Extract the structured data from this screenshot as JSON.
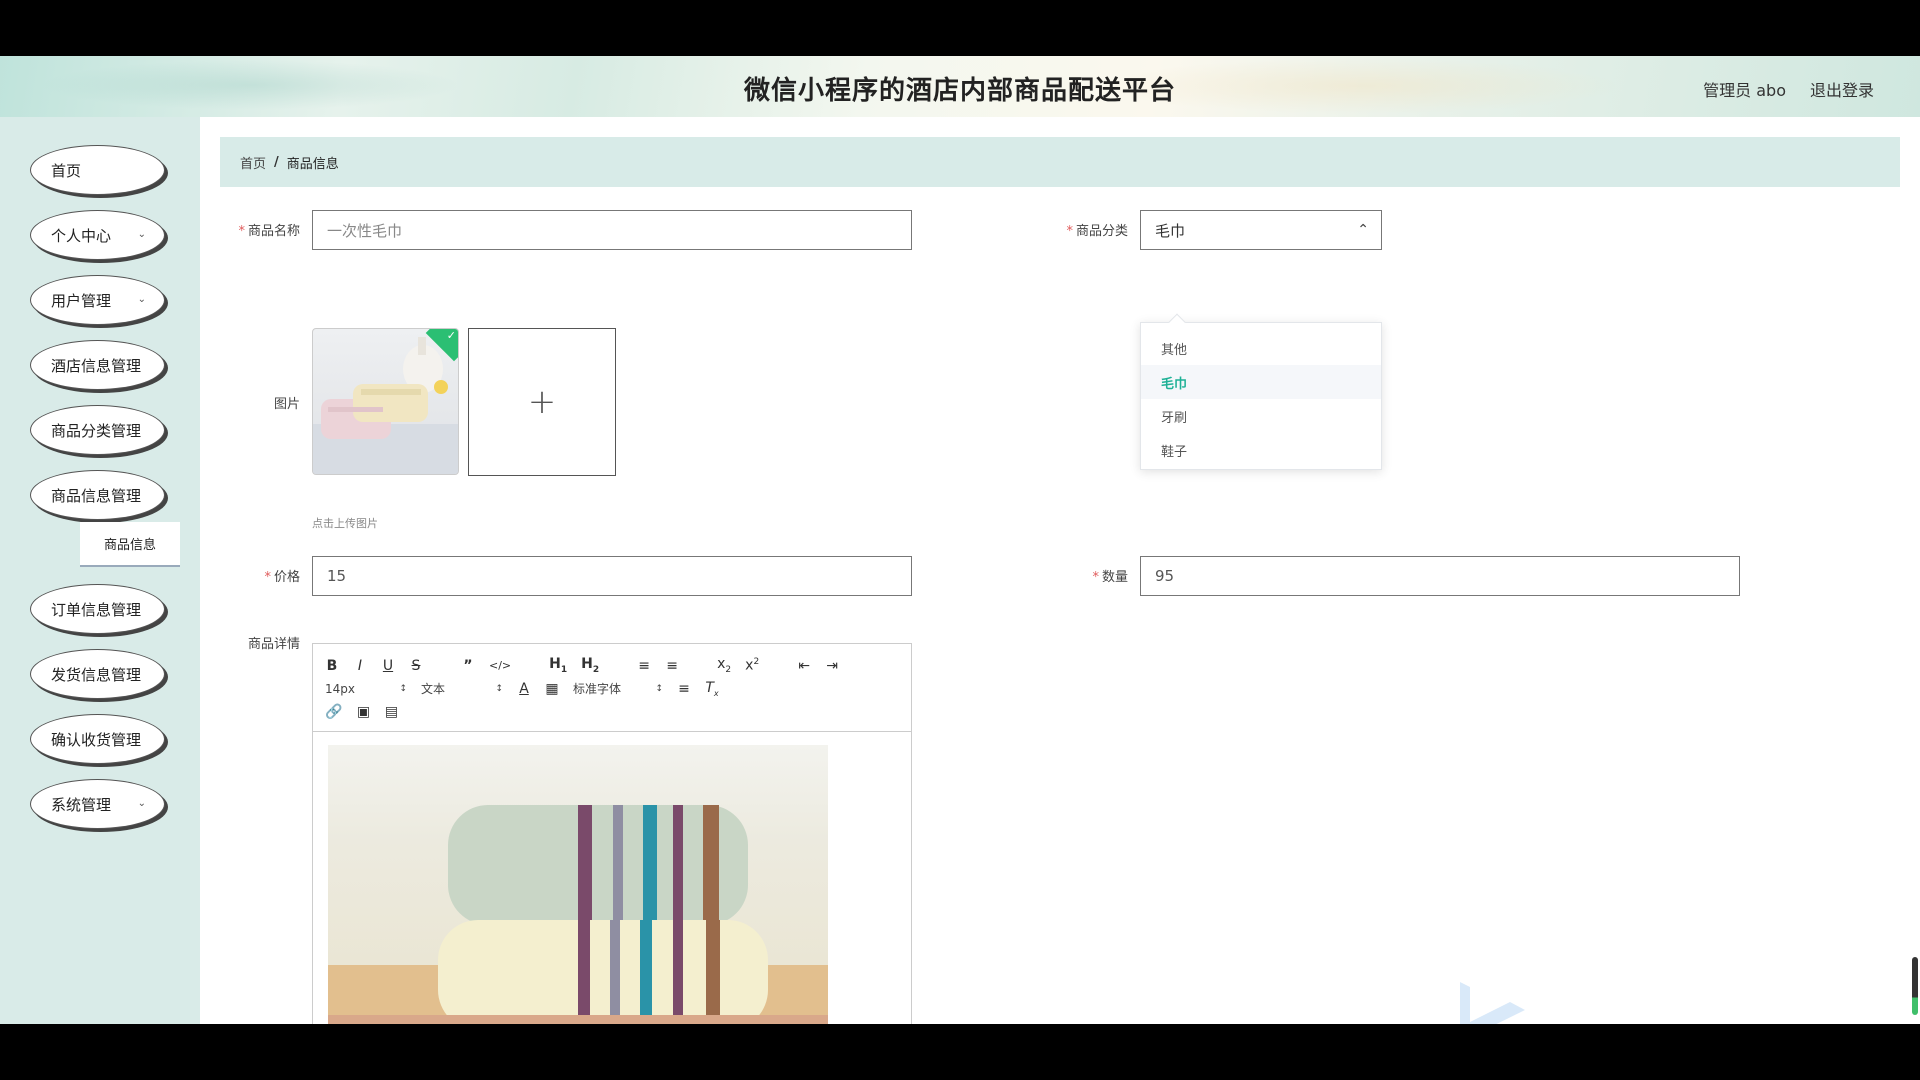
{
  "header": {
    "title": "微信小程序的酒店内部商品配送平台",
    "user_label": "管理员 abo",
    "logout_label": "退出登录"
  },
  "sidebar": {
    "items": [
      {
        "label": "首页",
        "expandable": false
      },
      {
        "label": "个人中心",
        "expandable": true
      },
      {
        "label": "用户管理",
        "expandable": true
      },
      {
        "label": "酒店信息管理",
        "expandable": false
      },
      {
        "label": "商品分类管理",
        "expandable": false
      },
      {
        "label": "商品信息管理",
        "expandable": false
      },
      {
        "label": "订单信息管理",
        "expandable": false
      },
      {
        "label": "发货信息管理",
        "expandable": false
      },
      {
        "label": "确认收货管理",
        "expandable": false
      },
      {
        "label": "系统管理",
        "expandable": true
      }
    ],
    "active_subitem": "商品信息"
  },
  "breadcrumb": {
    "home": "首页",
    "separator": "/",
    "current": "商品信息"
  },
  "form": {
    "product_name": {
      "label": "商品名称",
      "placeholder": "一次性毛巾"
    },
    "category": {
      "label": "商品分类",
      "value": "毛巾",
      "options": [
        "其他",
        "毛巾",
        "牙刷",
        "鞋子"
      ],
      "selected_index": 1
    },
    "image": {
      "label": "图片",
      "hint": "点击上传图片",
      "upload_icon": "plus-icon"
    },
    "price": {
      "label": "价格",
      "value": "15"
    },
    "quantity": {
      "label": "数量",
      "value": "95"
    },
    "details": {
      "label": "商品详情"
    }
  },
  "editor_toolbar": {
    "font_size": "14px",
    "header_picker": "文本",
    "font_picker": "标准字体",
    "buttons": [
      "bold-icon",
      "italic-icon",
      "underline-icon",
      "strike-icon",
      "blockquote-icon",
      "code-icon",
      "h1-icon",
      "h2-icon",
      "ordered-list-icon",
      "bullet-list-icon",
      "subscript-icon",
      "superscript-icon",
      "outdent-icon",
      "indent-icon",
      "color-icon",
      "background-icon",
      "align-icon",
      "clear-format-icon",
      "link-icon",
      "image-icon",
      "video-icon"
    ]
  },
  "colors": {
    "accent": "#1fb196",
    "sidebar_bg": "#d9ebe8",
    "required": "#e05a5a"
  }
}
